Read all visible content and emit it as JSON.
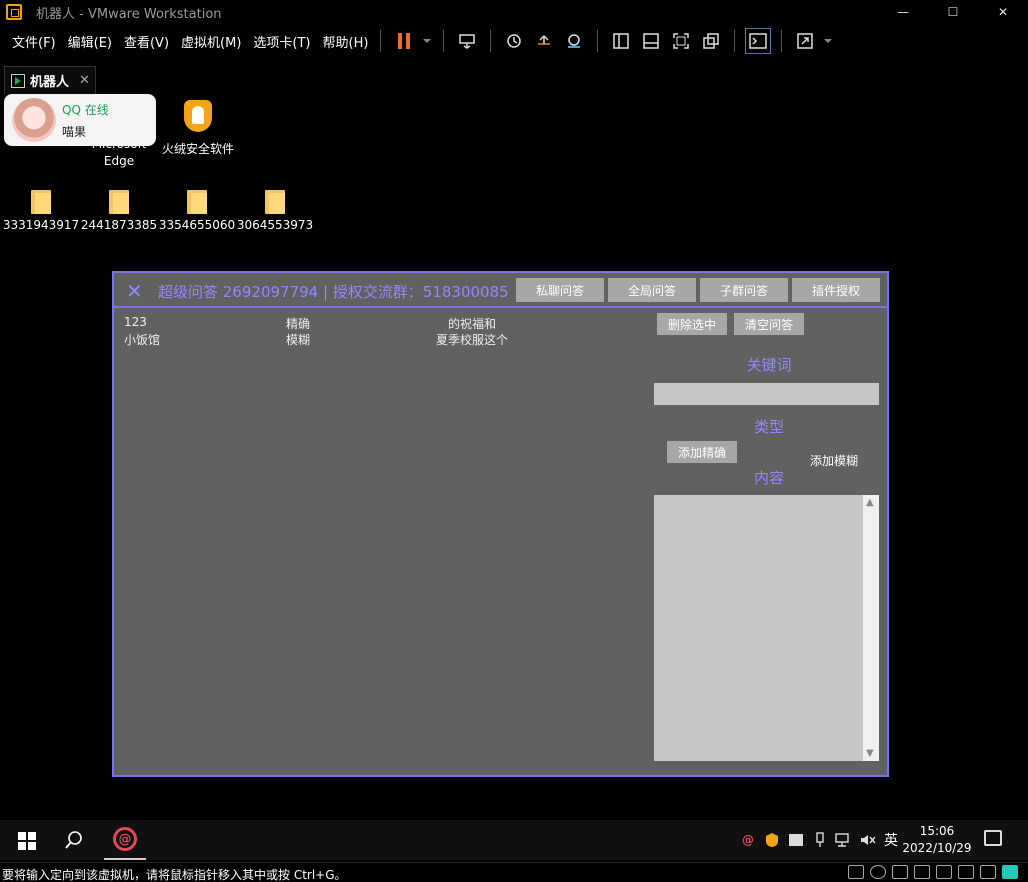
{
  "window": {
    "title": "机器人 - VMware Workstation",
    "minimize": "—",
    "maximize": "☐",
    "close": "✕"
  },
  "menu": [
    "文件(F)",
    "编辑(E)",
    "查看(V)",
    "虚拟机(M)",
    "选项卡(T)",
    "帮助(H)"
  ],
  "tab": {
    "label": "机器人",
    "close": "✕"
  },
  "desktop": {
    "qq_popup": {
      "status": "QQ 在线",
      "nick": "喵果"
    },
    "icons": [
      {
        "label": "Microsoft Edge"
      },
      {
        "label": "火绒安全软件"
      }
    ],
    "folders": [
      "3331943917",
      "2441873385",
      "3354655060",
      "3064553973"
    ]
  },
  "bot": {
    "close": "✕",
    "title": "超级问答 2692097794 | 授权交流群：518300085",
    "header_buttons": [
      "私聊问答",
      "全局问答",
      "子群问答",
      "插件授权"
    ],
    "rows": [
      {
        "key": "123",
        "type": "精确",
        "content": "的祝福和"
      },
      {
        "key": "小饭馆",
        "type": "模糊",
        "content": "夏季校服这个"
      }
    ],
    "delete_button": "删除选中",
    "clear_button": "清空问答",
    "keyword_label": "关键词",
    "type_label": "类型",
    "add_exact": "添加精确",
    "add_fuzzy": "添加模糊",
    "content_label": "内容",
    "scroll_up": "▲",
    "scroll_down": "▼"
  },
  "taskbar": {
    "ime": "英",
    "time": "15:06",
    "date": "2022/10/29"
  },
  "status": {
    "text": "要将输入定向到该虚拟机，请将鼠标指针移入其中或按 Ctrl+G。"
  },
  "colors": {
    "accent": "#7a72ee",
    "panel": "#616161",
    "qq_green": "#1ea05a",
    "qq_red": "#e04a5a"
  }
}
